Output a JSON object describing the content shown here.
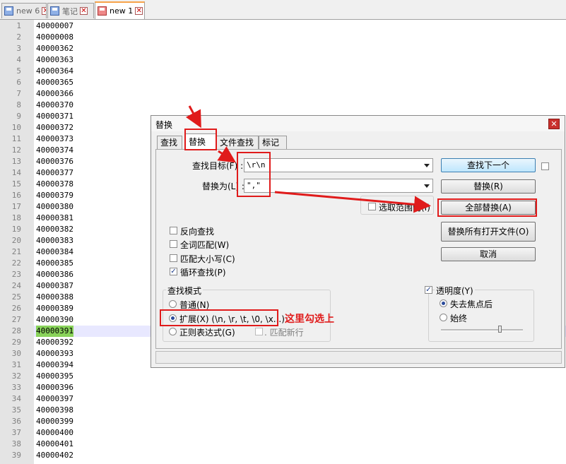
{
  "tabs": [
    {
      "label": "new 6",
      "state": "inactive"
    },
    {
      "label": "笔记",
      "state": "inactive"
    },
    {
      "label": "new 1",
      "state": "active"
    }
  ],
  "editor": {
    "line_numbers": [
      "1",
      "2",
      "3",
      "4",
      "5",
      "6",
      "7",
      "8",
      "9",
      "10",
      "11",
      "12",
      "13",
      "14",
      "15",
      "16",
      "17",
      "18",
      "19",
      "20",
      "21",
      "22",
      "23",
      "24",
      "25",
      "26",
      "27",
      "28",
      "29",
      "30",
      "31",
      "32",
      "33",
      "34",
      "35",
      "36",
      "37",
      "38",
      "39"
    ],
    "lines": [
      "40000007",
      "40000008",
      "40000362",
      "40000363",
      "40000364",
      "40000365",
      "40000366",
      "40000370",
      "40000371",
      "40000372",
      "40000373",
      "40000374",
      "40000376",
      "40000377",
      "40000378",
      "40000379",
      "40000380",
      "40000381",
      "40000382",
      "40000383",
      "40000384",
      "40000385",
      "40000386",
      "40000387",
      "40000388",
      "40000389",
      "40000390",
      "40000391",
      "40000392",
      "40000393",
      "40000394",
      "40000395",
      "40000396",
      "40000397",
      "40000398",
      "40000399",
      "40000400",
      "40000401",
      "40000402"
    ],
    "current_line": 28,
    "selection_color": "#89d35a"
  },
  "dialog": {
    "title": "替换",
    "close_icon": "close-icon",
    "tabs": [
      "查找",
      "替换",
      "文件查找",
      "标记"
    ],
    "active_tab": "替换",
    "find_label": "查找目标(F) :",
    "find_value": "\\r\\n",
    "replace_label": "替换为(L) :",
    "replace_value": "\",\"",
    "in_selection_label": "选取范围内(I)",
    "buttons": {
      "find_next": "查找下一个",
      "replace": "替换(R)",
      "replace_all": "全部替换(A)",
      "replace_all_open": "替换所有打开文件(O)",
      "cancel": "取消"
    },
    "options": {
      "reverse": {
        "label": "反向查找",
        "checked": false
      },
      "whole_word": {
        "label": "全词匹配(W)",
        "checked": false
      },
      "match_case": {
        "label": "匹配大小写(C)",
        "checked": false
      },
      "wrap": {
        "label": "循环查找(P)",
        "checked": true
      }
    },
    "search_mode": {
      "title": "查找模式",
      "normal": "普通(N)",
      "extended": "扩展(X) (\\n, \\r, \\t, \\0, \\x...)",
      "regex": "正则表达式(G)",
      "dot_newline": ". 匹配新行",
      "selected": "extended"
    },
    "transparency": {
      "title": "透明度(Y)",
      "checked": true,
      "on_lose_focus": "失去焦点后",
      "always": "始终",
      "selected": "on_lose_focus"
    }
  },
  "annotations": {
    "note": "这里勾选上",
    "color": "#e01b1b"
  }
}
